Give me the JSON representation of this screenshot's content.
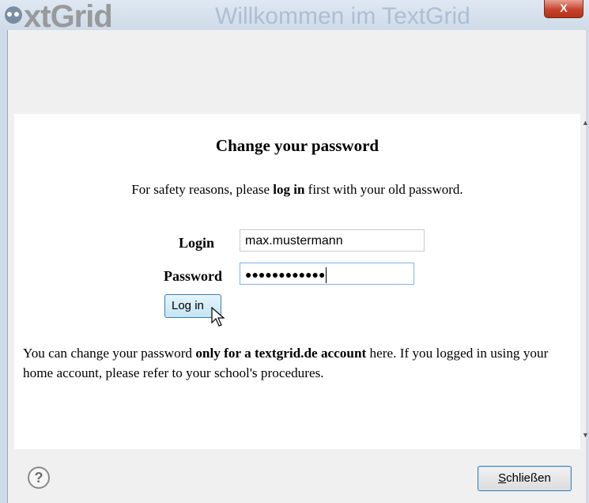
{
  "window": {
    "app_logo_text": "xtGrid",
    "title": "Willkommen im TextGrid",
    "close_glyph": "X"
  },
  "dialog": {
    "heading": "Change your password",
    "intro_prefix": "For safety reasons, please ",
    "intro_bold": "log in",
    "intro_suffix": " first with your old password.",
    "login_label": "Login",
    "login_value": "max.mustermann",
    "password_label": "Password",
    "password_value": "●●●●●●●●●●●●",
    "login_button": "Log in",
    "info_prefix": "You can change your password ",
    "info_bold": "only for a textgrid.de account",
    "info_suffix": " here. If you logged in using your home account, please refer to your school's procedures."
  },
  "footer": {
    "help_glyph": "?",
    "close_button_underlined": "S",
    "close_button_rest": "chließen"
  },
  "colors": {
    "accent_border": "#3c7fb1",
    "close_red": "#c7432c"
  }
}
